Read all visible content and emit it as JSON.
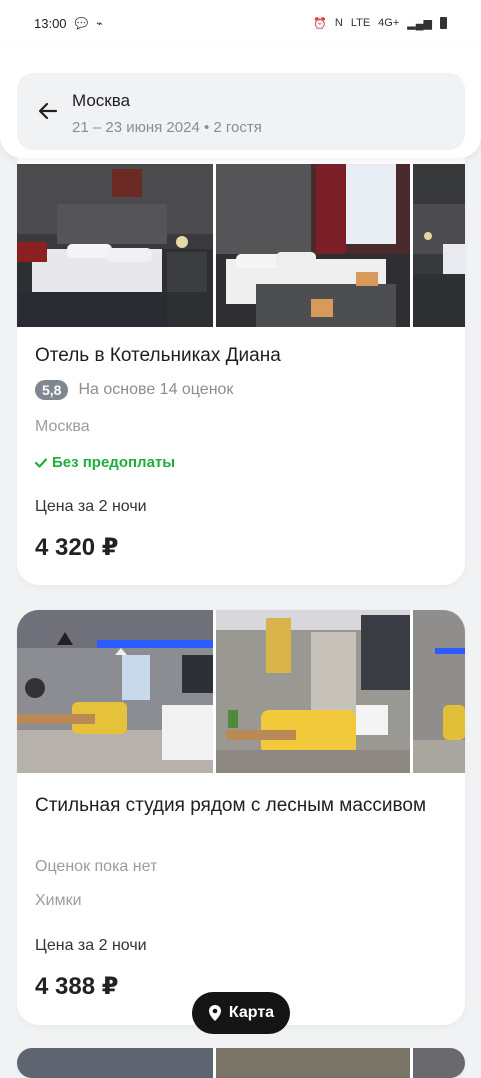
{
  "status_bar": {
    "time": "13:00",
    "network": "4G+"
  },
  "header": {
    "city": "Москва",
    "subtitle": "21 – 23 июня 2024 • 2 гостя"
  },
  "listings": [
    {
      "title": "Отель в Котельниках Диана",
      "rating": "5,8",
      "rating_text": "На основе 14 оценок",
      "city": "Москва",
      "prepay": "Без предоплаты",
      "price_label": "Цена за 2 ночи",
      "price": "4 320 ₽"
    },
    {
      "title": "Стильная студия рядом с лесным массивом",
      "rating_text": "Оценок пока нет",
      "city": "Химки",
      "price_label": "Цена за 2 ночи",
      "price": "4 388 ₽"
    }
  ],
  "map_button": {
    "label": "Карта"
  }
}
